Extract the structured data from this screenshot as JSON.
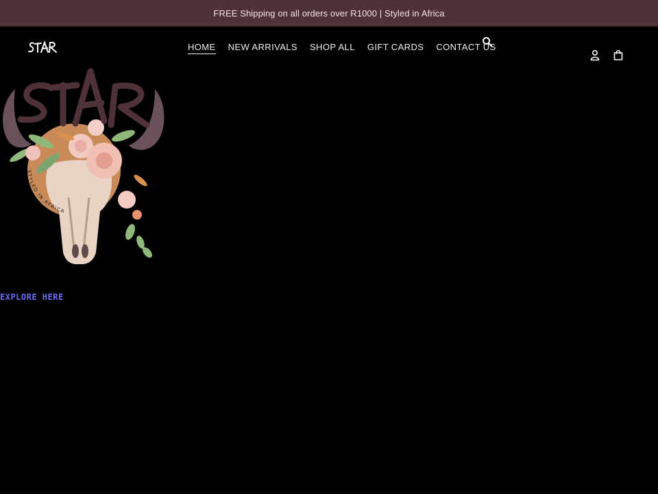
{
  "announcement": {
    "text": "FREE Shipping on all orders over R1000 | Styled in Africa",
    "background": "#4f3237"
  },
  "header": {
    "logo_text": "STAR",
    "nav": [
      {
        "label": "HOME",
        "active": true
      },
      {
        "label": "NEW ARRIVALS",
        "active": false
      },
      {
        "label": "SHOP ALL",
        "active": false
      },
      {
        "label": "GIFT CARDS",
        "active": false
      },
      {
        "label": "CONTACT US",
        "active": false
      }
    ],
    "icons": {
      "search": "search-icon",
      "account": "account-icon",
      "cart": "cart-icon"
    }
  },
  "hero": {
    "logo_title": "STAR",
    "logo_tagline": "STYLED IN AFRICA",
    "explore_link": "EXPLORE HERE",
    "link_color": "#6b6bf0"
  },
  "colors": {
    "page_background": "#000000",
    "brand_plum": "#4f3237",
    "sun_orange": "#c98a5a"
  }
}
